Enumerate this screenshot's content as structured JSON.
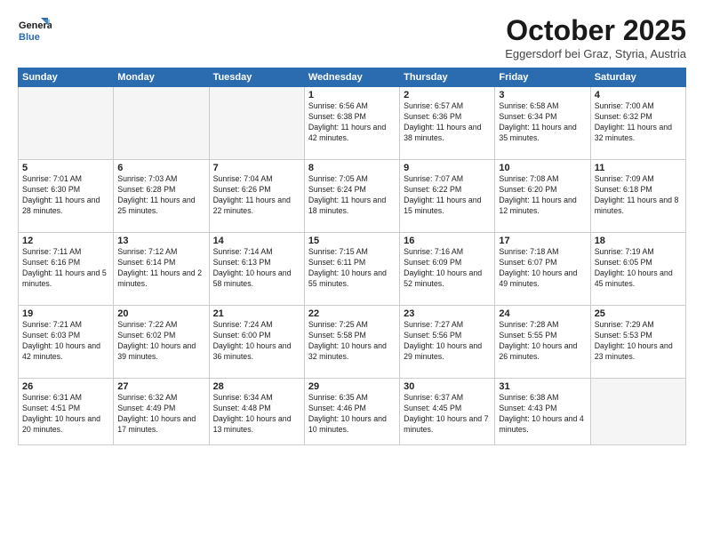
{
  "header": {
    "logo_line1": "General",
    "logo_line2": "Blue",
    "month": "October 2025",
    "location": "Eggersdorf bei Graz, Styria, Austria"
  },
  "weekdays": [
    "Sunday",
    "Monday",
    "Tuesday",
    "Wednesday",
    "Thursday",
    "Friday",
    "Saturday"
  ],
  "weeks": [
    [
      {
        "day": "",
        "info": ""
      },
      {
        "day": "",
        "info": ""
      },
      {
        "day": "",
        "info": ""
      },
      {
        "day": "1",
        "info": "Sunrise: 6:56 AM\nSunset: 6:38 PM\nDaylight: 11 hours\nand 42 minutes."
      },
      {
        "day": "2",
        "info": "Sunrise: 6:57 AM\nSunset: 6:36 PM\nDaylight: 11 hours\nand 38 minutes."
      },
      {
        "day": "3",
        "info": "Sunrise: 6:58 AM\nSunset: 6:34 PM\nDaylight: 11 hours\nand 35 minutes."
      },
      {
        "day": "4",
        "info": "Sunrise: 7:00 AM\nSunset: 6:32 PM\nDaylight: 11 hours\nand 32 minutes."
      }
    ],
    [
      {
        "day": "5",
        "info": "Sunrise: 7:01 AM\nSunset: 6:30 PM\nDaylight: 11 hours\nand 28 minutes."
      },
      {
        "day": "6",
        "info": "Sunrise: 7:03 AM\nSunset: 6:28 PM\nDaylight: 11 hours\nand 25 minutes."
      },
      {
        "day": "7",
        "info": "Sunrise: 7:04 AM\nSunset: 6:26 PM\nDaylight: 11 hours\nand 22 minutes."
      },
      {
        "day": "8",
        "info": "Sunrise: 7:05 AM\nSunset: 6:24 PM\nDaylight: 11 hours\nand 18 minutes."
      },
      {
        "day": "9",
        "info": "Sunrise: 7:07 AM\nSunset: 6:22 PM\nDaylight: 11 hours\nand 15 minutes."
      },
      {
        "day": "10",
        "info": "Sunrise: 7:08 AM\nSunset: 6:20 PM\nDaylight: 11 hours\nand 12 minutes."
      },
      {
        "day": "11",
        "info": "Sunrise: 7:09 AM\nSunset: 6:18 PM\nDaylight: 11 hours\nand 8 minutes."
      }
    ],
    [
      {
        "day": "12",
        "info": "Sunrise: 7:11 AM\nSunset: 6:16 PM\nDaylight: 11 hours\nand 5 minutes."
      },
      {
        "day": "13",
        "info": "Sunrise: 7:12 AM\nSunset: 6:14 PM\nDaylight: 11 hours\nand 2 minutes."
      },
      {
        "day": "14",
        "info": "Sunrise: 7:14 AM\nSunset: 6:13 PM\nDaylight: 10 hours\nand 58 minutes."
      },
      {
        "day": "15",
        "info": "Sunrise: 7:15 AM\nSunset: 6:11 PM\nDaylight: 10 hours\nand 55 minutes."
      },
      {
        "day": "16",
        "info": "Sunrise: 7:16 AM\nSunset: 6:09 PM\nDaylight: 10 hours\nand 52 minutes."
      },
      {
        "day": "17",
        "info": "Sunrise: 7:18 AM\nSunset: 6:07 PM\nDaylight: 10 hours\nand 49 minutes."
      },
      {
        "day": "18",
        "info": "Sunrise: 7:19 AM\nSunset: 6:05 PM\nDaylight: 10 hours\nand 45 minutes."
      }
    ],
    [
      {
        "day": "19",
        "info": "Sunrise: 7:21 AM\nSunset: 6:03 PM\nDaylight: 10 hours\nand 42 minutes."
      },
      {
        "day": "20",
        "info": "Sunrise: 7:22 AM\nSunset: 6:02 PM\nDaylight: 10 hours\nand 39 minutes."
      },
      {
        "day": "21",
        "info": "Sunrise: 7:24 AM\nSunset: 6:00 PM\nDaylight: 10 hours\nand 36 minutes."
      },
      {
        "day": "22",
        "info": "Sunrise: 7:25 AM\nSunset: 5:58 PM\nDaylight: 10 hours\nand 32 minutes."
      },
      {
        "day": "23",
        "info": "Sunrise: 7:27 AM\nSunset: 5:56 PM\nDaylight: 10 hours\nand 29 minutes."
      },
      {
        "day": "24",
        "info": "Sunrise: 7:28 AM\nSunset: 5:55 PM\nDaylight: 10 hours\nand 26 minutes."
      },
      {
        "day": "25",
        "info": "Sunrise: 7:29 AM\nSunset: 5:53 PM\nDaylight: 10 hours\nand 23 minutes."
      }
    ],
    [
      {
        "day": "26",
        "info": "Sunrise: 6:31 AM\nSunset: 4:51 PM\nDaylight: 10 hours\nand 20 minutes."
      },
      {
        "day": "27",
        "info": "Sunrise: 6:32 AM\nSunset: 4:49 PM\nDaylight: 10 hours\nand 17 minutes."
      },
      {
        "day": "28",
        "info": "Sunrise: 6:34 AM\nSunset: 4:48 PM\nDaylight: 10 hours\nand 13 minutes."
      },
      {
        "day": "29",
        "info": "Sunrise: 6:35 AM\nSunset: 4:46 PM\nDaylight: 10 hours\nand 10 minutes."
      },
      {
        "day": "30",
        "info": "Sunrise: 6:37 AM\nSunset: 4:45 PM\nDaylight: 10 hours\nand 7 minutes."
      },
      {
        "day": "31",
        "info": "Sunrise: 6:38 AM\nSunset: 4:43 PM\nDaylight: 10 hours\nand 4 minutes."
      },
      {
        "day": "",
        "info": ""
      }
    ]
  ]
}
